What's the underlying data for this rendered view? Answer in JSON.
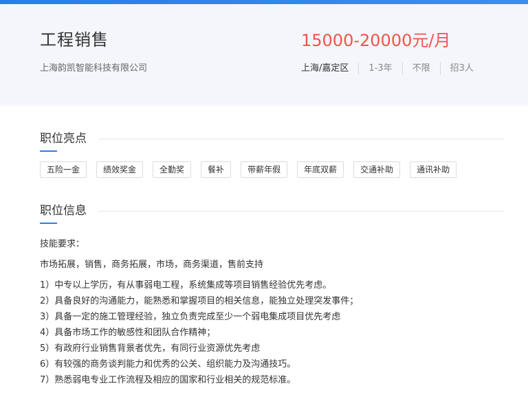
{
  "job": {
    "title": "工程销售",
    "company": "上海韵凯智能科技有限公司",
    "salary": "15000-20000元/月",
    "meta": [
      "上海/嘉定区",
      "1-3年",
      "不限",
      "招3人"
    ]
  },
  "highlights": {
    "title": "职位亮点",
    "tags": [
      "五险一金",
      "绩效奖金",
      "全勤奖",
      "餐补",
      "带薪年假",
      "年底双薪",
      "交通补助",
      "通讯补助"
    ]
  },
  "info": {
    "title": "职位信息",
    "skills_label": "技能要求：",
    "skills": "市场拓展，销售，商务拓展，市场，商务渠道，售前支持",
    "requirements": [
      "1）中专以上学历，有从事弱电工程，系统集成等项目销售经验优先考虑。",
      "2）具备良好的沟通能力，能熟悉和掌握项目的相关信息，能独立处理突发事件；",
      "3）具备一定的施工管理经验，独立负责完成至少一个弱电集成项目优先考虑",
      "4）具备市场工作的敏感性和团队合作精神；",
      "5）有政府行业销售背景者优先，有同行业资源优先考虑",
      "6）有较强的商务谈判能力和优秀的公关、组织能力及沟通技巧。",
      "7）熟悉弱电专业工作流程及相应的国家和行业相关的规范标准。"
    ]
  }
}
